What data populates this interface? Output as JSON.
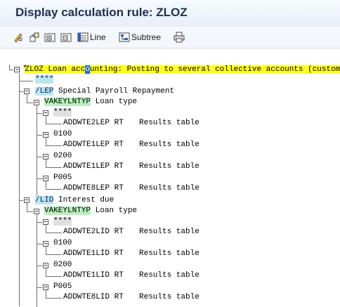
{
  "window": {
    "title": "Display calculation rule: ZLOZ"
  },
  "toolbar": {
    "icons": [
      "pencil-glasses-icon",
      "other-object-icon",
      "expand-node-icon",
      "collapse-node-icon",
      "line-icon",
      "subtree-icon",
      "print-icon"
    ],
    "line_label": "Line",
    "subtree_label": "Subtree"
  },
  "tree": {
    "root": {
      "code": "ZLOZ",
      "text_before_cursor": "Loan acc",
      "cursor_char": "o",
      "text_after_cursor": "unting: Posting to several collective accounts (custom)"
    },
    "star_node": "*",
    "stars_node": "****",
    "groups": [
      {
        "code": "/LEP",
        "text": "Special Payroll Repayment",
        "var_code": "VAKEYLNTYP",
        "var_text": "Loan type",
        "entries": [
          {
            "key": "****",
            "op": "ADDWTE2LEP RT",
            "desc": "Results table"
          },
          {
            "key": "0100",
            "op": "ADDWTE1LEP RT",
            "desc": "Results table"
          },
          {
            "key": "0200",
            "op": "ADDWTE1LEP RT",
            "desc": "Results table"
          },
          {
            "key": "P005",
            "op": "ADDWTE8LEP RT",
            "desc": "Results table"
          }
        ]
      },
      {
        "code": "/LID",
        "text": "Interest due",
        "var_code": "VAKEYLNTYP",
        "var_text": "Loan type",
        "entries": [
          {
            "key": "****",
            "op": "ADDWTE2LID RT",
            "desc": "Results table"
          },
          {
            "key": "0100",
            "op": "ADDWTE1LID RT",
            "desc": "Results table"
          },
          {
            "key": "0200",
            "op": "ADDWTE1LID RT",
            "desc": "Results table"
          },
          {
            "key": "P005",
            "op": "ADDWTE8LID RT",
            "desc": "Results table"
          }
        ]
      }
    ]
  }
}
